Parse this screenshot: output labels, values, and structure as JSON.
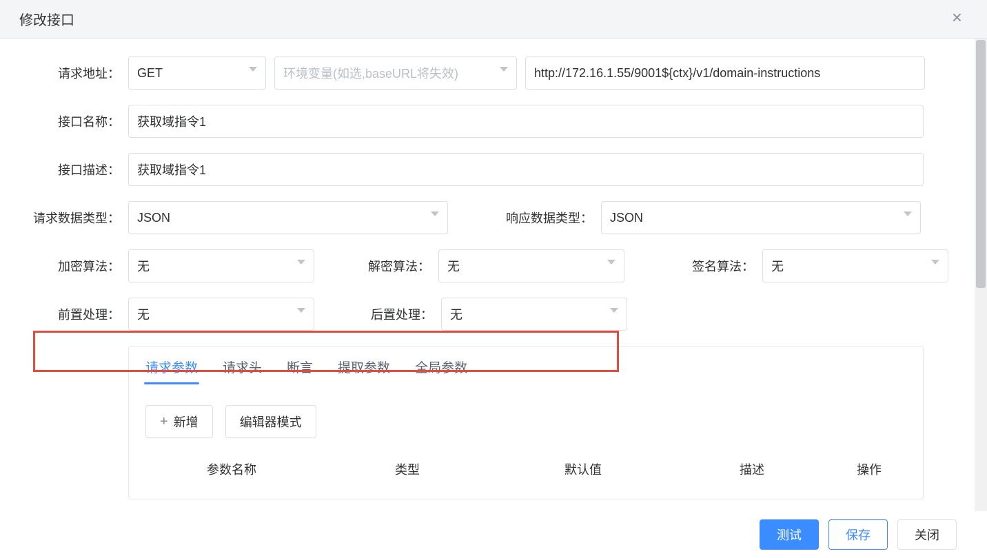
{
  "modal": {
    "title": "修改接口"
  },
  "labels": {
    "request_url": "请求地址：",
    "api_name": "接口名称：",
    "api_desc": "接口描述：",
    "req_data_type": "请求数据类型：",
    "resp_data_type": "响应数据类型：",
    "encrypt": "加密算法：",
    "decrypt": "解密算法：",
    "sign": "签名算法：",
    "pre_process": "前置处理：",
    "post_process": "后置处理："
  },
  "fields": {
    "method": "GET",
    "env_placeholder": "环境变量(如选,baseURL将失效)",
    "url": "http://172.16.1.55/9001${ctx}/v1/domain-instructions",
    "api_name": "获取域指令1",
    "api_desc": "获取域指令1",
    "req_data_type": "JSON",
    "resp_data_type": "JSON",
    "encrypt": "无",
    "decrypt": "无",
    "sign": "无",
    "pre_process": "无",
    "post_process": "无"
  },
  "tabs": {
    "items": [
      "请求参数",
      "请求头",
      "断言",
      "提取参数",
      "全局参数"
    ],
    "active_index": 0,
    "add_btn": "新增",
    "editor_mode_btn": "编辑器模式",
    "columns": [
      "参数名称",
      "类型",
      "默认值",
      "描述",
      "操作"
    ]
  },
  "footer": {
    "test": "测试",
    "save": "保存",
    "close": "关闭"
  }
}
